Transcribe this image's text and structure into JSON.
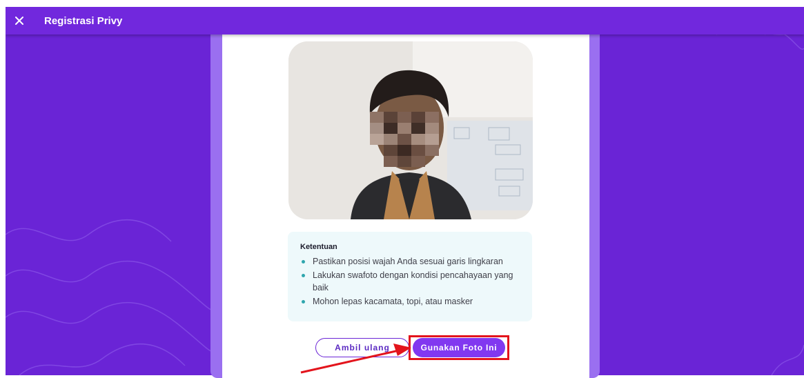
{
  "header": {
    "title": "Registrasi Privy",
    "close_icon": "close-icon"
  },
  "selfie": {
    "photo_desc_icon": "selfie-photo"
  },
  "rules": {
    "title": "Ketentuan",
    "items": [
      "Pastikan posisi wajah Anda sesuai garis lingkaran",
      "Lakukan swafoto dengan kondisi pencahayaan yang baik",
      "Mohon lepas kacamata, topi, atau masker"
    ]
  },
  "actions": {
    "retake_label": "Ambil ulang",
    "use_label": "Gunakan Foto Ini"
  },
  "colors": {
    "brand": "#6a24d6",
    "card_border": "#9a6ff0",
    "primary_button": "#8138f0",
    "highlight": "#e3141c",
    "bullet": "#2ea6ad"
  }
}
